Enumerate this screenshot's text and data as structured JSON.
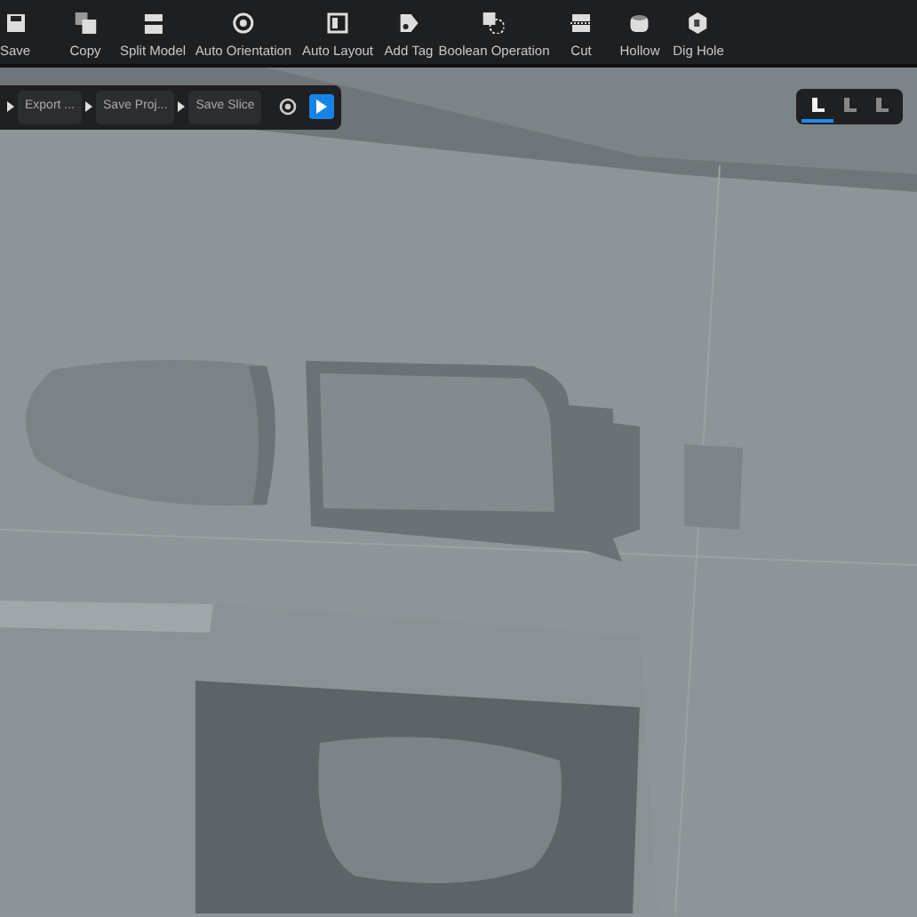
{
  "toolbar": [
    {
      "label": "Save"
    },
    {
      "label": "Copy"
    },
    {
      "label": "Split Model"
    },
    {
      "label": "Auto Orientation"
    },
    {
      "label": "Auto Layout"
    },
    {
      "label": "Add Tag"
    },
    {
      "label": "Boolean Operation"
    },
    {
      "label": "Cut"
    },
    {
      "label": "Hollow"
    },
    {
      "label": "Dig Hole"
    }
  ],
  "workflow": {
    "steps": [
      "Export ...",
      "Save Proj...",
      "Save Slice"
    ]
  },
  "view_modes": [
    {
      "selected": true
    },
    {
      "selected": false
    },
    {
      "selected": false
    }
  ]
}
